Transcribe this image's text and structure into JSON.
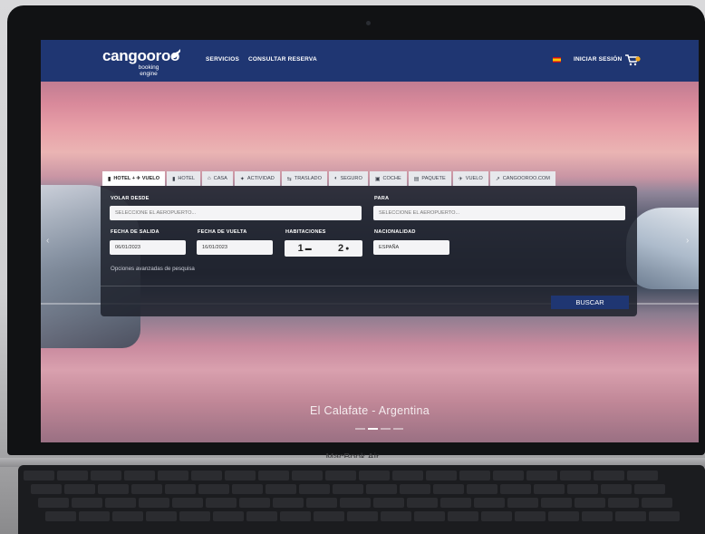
{
  "header": {
    "logo": "cangooroo",
    "logo_sub": "booking engine",
    "nav": [
      "SERVICIOS",
      "CONSULTAR RESERVA"
    ],
    "login": "INICIAR SESIÓN"
  },
  "tabs": [
    {
      "label": "HOTEL + ✈ VUELO",
      "icon": "hotel-icon",
      "active": true
    },
    {
      "label": "HOTEL",
      "icon": "hotel-icon",
      "active": false
    },
    {
      "label": "CASA",
      "icon": "house-icon",
      "active": false
    },
    {
      "label": "ACTIVIDAD",
      "icon": "activity-icon",
      "active": false
    },
    {
      "label": "TRASLADO",
      "icon": "transfer-icon",
      "active": false
    },
    {
      "label": "SEGURO",
      "icon": "shield-icon",
      "active": false
    },
    {
      "label": "COCHE",
      "icon": "car-icon",
      "active": false
    },
    {
      "label": "PAQUETE",
      "icon": "package-icon",
      "active": false
    },
    {
      "label": "VUELO",
      "icon": "plane-icon",
      "active": false
    },
    {
      "label": "CANGOOROO.COM",
      "icon": "external-link-icon",
      "active": false
    }
  ],
  "form": {
    "from_label": "VOLAR DESDE",
    "from_placeholder": "SELECCIONE EL AEROPUERTO...",
    "to_label": "PARA",
    "to_placeholder": "SELECCIONE EL AEROPUERTO...",
    "departure_label": "FECHA DE SALIDA",
    "departure_value": "06/01/2023",
    "return_label": "FECHA DE VUELTA",
    "return_value": "16/01/2023",
    "rooms_label": "HABITACIONES",
    "rooms_value": "1",
    "guests_value": "2",
    "nationality_label": "NACIONALIDAD",
    "nationality_value": "ESPAÑA",
    "advanced_link": "Opciones avanzadas de pesquisa",
    "search_button": "BUSCAR"
  },
  "caption": "El Calafate - Argentina",
  "slides": {
    "count": 4,
    "active_index": 1
  },
  "laptop_label": "MacBook Air"
}
